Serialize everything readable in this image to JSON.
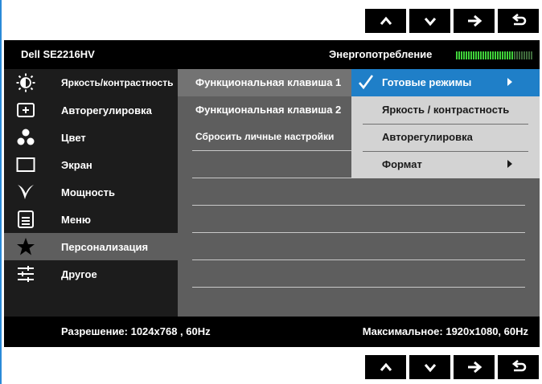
{
  "nav": {
    "buttons": [
      "up-arrow",
      "down-arrow",
      "right-arrow",
      "back-arrow"
    ]
  },
  "header": {
    "model": "Dell SE2216HV",
    "power_label": "Энергопотребление",
    "power_level": 0.75
  },
  "sidebar": {
    "items": [
      {
        "label": "Яркость/контрастность",
        "icon": "brightness-icon"
      },
      {
        "label": "Авторегулировка",
        "icon": "auto-adjust-icon"
      },
      {
        "label": "Цвет",
        "icon": "color-icon"
      },
      {
        "label": "Экран",
        "icon": "display-icon"
      },
      {
        "label": "Мощность",
        "icon": "power-leaf-icon"
      },
      {
        "label": "Меню",
        "icon": "menu-icon"
      },
      {
        "label": "Персонализация",
        "icon": "star-icon"
      },
      {
        "label": "Другое",
        "icon": "sliders-icon"
      }
    ],
    "selected": "Персонализация"
  },
  "middle": {
    "items": [
      {
        "label": "Функциональная клавиша 1"
      },
      {
        "label": "Функциональная клавиша 2"
      },
      {
        "label": "Сбросить личные настройки"
      }
    ]
  },
  "submenu": {
    "items": [
      {
        "label": "Готовые режимы",
        "checked": true,
        "has_arrow": true
      },
      {
        "label": "Яркость / контрастность",
        "checked": false,
        "has_arrow": false
      },
      {
        "label": "Авторегулировка",
        "checked": false,
        "has_arrow": false
      },
      {
        "label": "Формат",
        "checked": false,
        "has_arrow": true
      }
    ]
  },
  "footer": {
    "resolution": "Разрешение: 1024x768 , 60Hz",
    "max_resolution": "Максимальное: 1920x1080, 60Hz"
  },
  "colors": {
    "accent": "#1f7fc8",
    "power_on": "#3fd23a"
  }
}
